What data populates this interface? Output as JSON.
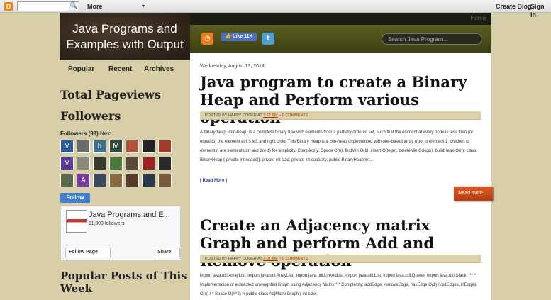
{
  "navbar": {
    "logo": "B",
    "search_button": "🔍",
    "more": "More",
    "more_caret": "▾",
    "create_blog": "Create Blog",
    "sign_in": "Sign In"
  },
  "blog": {
    "title": "Java Programs and Examples with Output",
    "home": "Home"
  },
  "tabs": [
    "Popular",
    "Recent",
    "Archives"
  ],
  "sidebar": {
    "total_pageviews": "Total Pageviews",
    "followers_heading": "Followers",
    "followers_count": "Followers (98)",
    "followers_next": "Next",
    "follow_button": "Follow",
    "follower_avatars": [
      {
        "letter": "M",
        "color": "#2b5aa0"
      },
      {
        "letter": "",
        "color": "#6b6b6b"
      },
      {
        "letter": "h",
        "color": "#3d6f8e"
      },
      {
        "letter": "M",
        "color": "#2f4a3a"
      },
      {
        "letter": "",
        "color": "#b0533a"
      },
      {
        "letter": "",
        "color": "#222222"
      },
      {
        "letter": "",
        "color": "#a33a2a"
      },
      {
        "letter": "M",
        "color": "#5a3aa0"
      },
      {
        "letter": "",
        "color": "#8a8a7a"
      },
      {
        "letter": "",
        "color": "#3a3a2a"
      },
      {
        "letter": "",
        "color": "#4a7a3a"
      },
      {
        "letter": "",
        "color": "#5a4a3a"
      },
      {
        "letter": "",
        "color": "#a02020"
      },
      {
        "letter": "",
        "color": "#2a2a2a"
      },
      {
        "letter": "",
        "color": "#5a6a4a"
      },
      {
        "letter": "A",
        "color": "#7a3aa0"
      },
      {
        "letter": "",
        "color": "#3a4a5a"
      },
      {
        "letter": "",
        "color": "#8a6a3a"
      },
      {
        "letter": "",
        "color": "#5a3a2a"
      },
      {
        "letter": "",
        "color": "#2a3a4a"
      },
      {
        "letter": "",
        "color": "#7a5a3a"
      }
    ],
    "fb_page_name": "Java Programs and E...",
    "fb_followers": "11,803 followers",
    "fb_follow_page": "Follow Page",
    "fb_share": "Share",
    "popular_posts": "Popular Posts of This Week"
  },
  "social": {
    "rss": "◔",
    "like": "👍 Like 11K",
    "twitter": "t",
    "search_placeholder": "Search Java Program..."
  },
  "posts": [
    {
      "date": "Wednesday, August 13, 2014",
      "title": "Java program to create a Binary Heap and Perform various operation",
      "meta_prefix": "Posted by Happy Coder at ",
      "time": "3:27 PM",
      "meta_sep": " – ",
      "comments": "0 comments",
      "body": "A binary heap (min-heap) is a complete binary tree with elements from a partially ordered set, such that the element at every node is less than (or equal to) the element at it's left and right child. This Binary Heap is a min-heap implemented with one-based array (root is element 1; children of element n are elements 2n and 2n+1) for simplicity. Complexity: Space O(n), findMin O(1), insert O(logn), deleteMin O(logn), buildHeap O(n); class BinaryHeap { private int nodes[]; private int size; private int capacity; public BinaryHeap(int...",
      "read_more_link": "[ Read More ]",
      "read_more_button": "Read more ..."
    },
    {
      "title": "Create an Adjacency matrix Graph and perform Add and Remove operation",
      "meta_prefix": "Posted by Happy Coder at ",
      "time": "3:07 PM",
      "meta_sep": " – ",
      "comments": "0 comments",
      "body": "import java.util.ArrayList; import java.util.ArrayList; import java.util.LinkedList; import java.util.List; import java.util.Queue; import java.util.Stack; /** * Implementation of a directed unweighted Graph using Adjacency Matrix * * Complexity: addEdge, removeEdge, hasEdge O(1) / outEdges, inEdges O(n) / * Space O(n^2) */ public class AdjMatrixGraph { int size;"
    }
  ]
}
